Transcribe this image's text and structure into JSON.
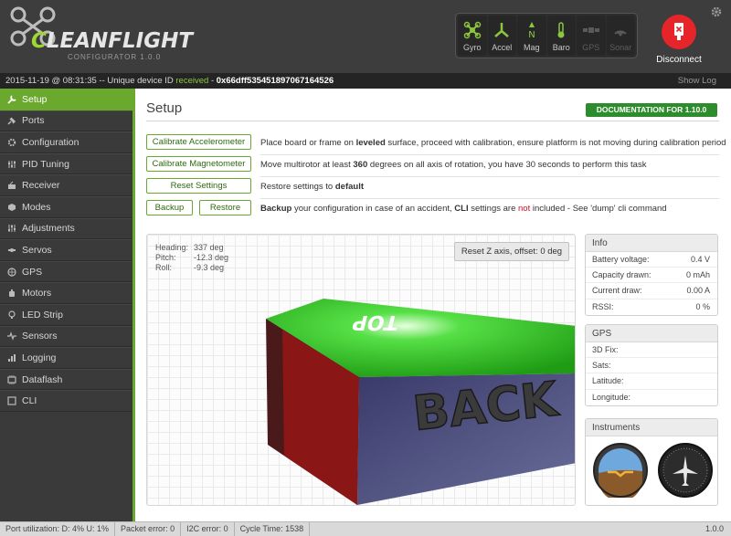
{
  "app": {
    "logo_text_c": "C",
    "logo_text_rest": "LEANFLIGHT",
    "logo_sub": "CONFIGURATOR   1.0.0",
    "disconnect_label": "Disconnect"
  },
  "sensors": [
    {
      "name": "Gyro",
      "active": true
    },
    {
      "name": "Accel",
      "active": true
    },
    {
      "name": "Mag",
      "active": true
    },
    {
      "name": "Baro",
      "active": true
    },
    {
      "name": "GPS",
      "active": false
    },
    {
      "name": "Sonar",
      "active": false
    }
  ],
  "status": {
    "prefix": "2015-11-19 @ 08:31:35 -- Unique device ID ",
    "received": "received",
    "dash": " - ",
    "device_id": "0x66dff535451897067164526",
    "show_log": "Show Log"
  },
  "nav": [
    {
      "label": "Setup",
      "icon": "wrench-icon",
      "active": true
    },
    {
      "label": "Ports",
      "icon": "plug-icon"
    },
    {
      "label": "Configuration",
      "icon": "gear-icon"
    },
    {
      "label": "PID Tuning",
      "icon": "sliders-icon"
    },
    {
      "label": "Receiver",
      "icon": "receiver-icon"
    },
    {
      "label": "Modes",
      "icon": "cube-icon"
    },
    {
      "label": "Adjustments",
      "icon": "adjust-icon"
    },
    {
      "label": "Servos",
      "icon": "servo-icon"
    },
    {
      "label": "GPS",
      "icon": "globe-icon"
    },
    {
      "label": "Motors",
      "icon": "motor-icon"
    },
    {
      "label": "LED Strip",
      "icon": "bulb-icon"
    },
    {
      "label": "Sensors",
      "icon": "pulse-icon"
    },
    {
      "label": "Logging",
      "icon": "log-icon"
    },
    {
      "label": "Dataflash",
      "icon": "flash-icon"
    },
    {
      "label": "CLI",
      "icon": "terminal-icon"
    }
  ],
  "setup": {
    "title": "Setup",
    "doc_button": "DOCUMENTATION FOR 1.10.0",
    "calibrate_accel": "Calibrate Accelerometer",
    "calibrate_accel_desc_1": "Place board or frame on ",
    "calibrate_accel_desc_b": "leveled",
    "calibrate_accel_desc_2": " surface, proceed with calibration, ensure platform is not moving during calibration period",
    "calibrate_mag": "Calibrate Magnetometer",
    "calibrate_mag_desc_1": "Move multirotor at least ",
    "calibrate_mag_desc_b": "360",
    "calibrate_mag_desc_2": " degrees on all axis of rotation, you have 30 seconds to perform this task",
    "reset_settings": "Reset Settings",
    "reset_desc_1": "Restore settings to ",
    "reset_desc_b": "default",
    "backup": "Backup",
    "restore": "Restore",
    "backup_desc_b1": "Backup",
    "backup_desc_1": " your configuration in case of an accident, ",
    "backup_desc_b2": "CLI",
    "backup_desc_2": " settings are ",
    "backup_desc_red": "not",
    "backup_desc_3": " included - See 'dump' cli command"
  },
  "attitude": {
    "heading_label": "Heading:",
    "heading_value": "337 deg",
    "pitch_label": "Pitch:",
    "pitch_value": "-12.3 deg",
    "roll_label": "Roll:",
    "roll_value": "-9.3 deg",
    "reset_z": "Reset Z axis, offset: 0 deg",
    "model_back": "BACK",
    "model_top": "TOP"
  },
  "info": {
    "title": "Info",
    "rows": [
      {
        "label": "Battery voltage:",
        "value": "0.4 V"
      },
      {
        "label": "Capacity drawn:",
        "value": "0 mAh"
      },
      {
        "label": "Current draw:",
        "value": "0.00 A"
      },
      {
        "label": "RSSI:",
        "value": "0 %"
      }
    ]
  },
  "gps": {
    "title": "GPS",
    "rows": [
      {
        "label": "3D Fix:",
        "value": ""
      },
      {
        "label": "Sats:",
        "value": ""
      },
      {
        "label": "Latitude:",
        "value": ""
      },
      {
        "label": "Longitude:",
        "value": ""
      }
    ]
  },
  "instruments": {
    "title": "Instruments"
  },
  "footer": {
    "port_util": "Port utilization: D: 4% U: 1%",
    "packet_error": "Packet error: 0",
    "i2c_error": "I2C error: 0",
    "cycle_time": "Cycle Time: 1538",
    "version": "1.0.0"
  },
  "colors": {
    "accent": "#6ba82e",
    "disconnect": "#e5252a",
    "doc": "#2d8d2d"
  }
}
